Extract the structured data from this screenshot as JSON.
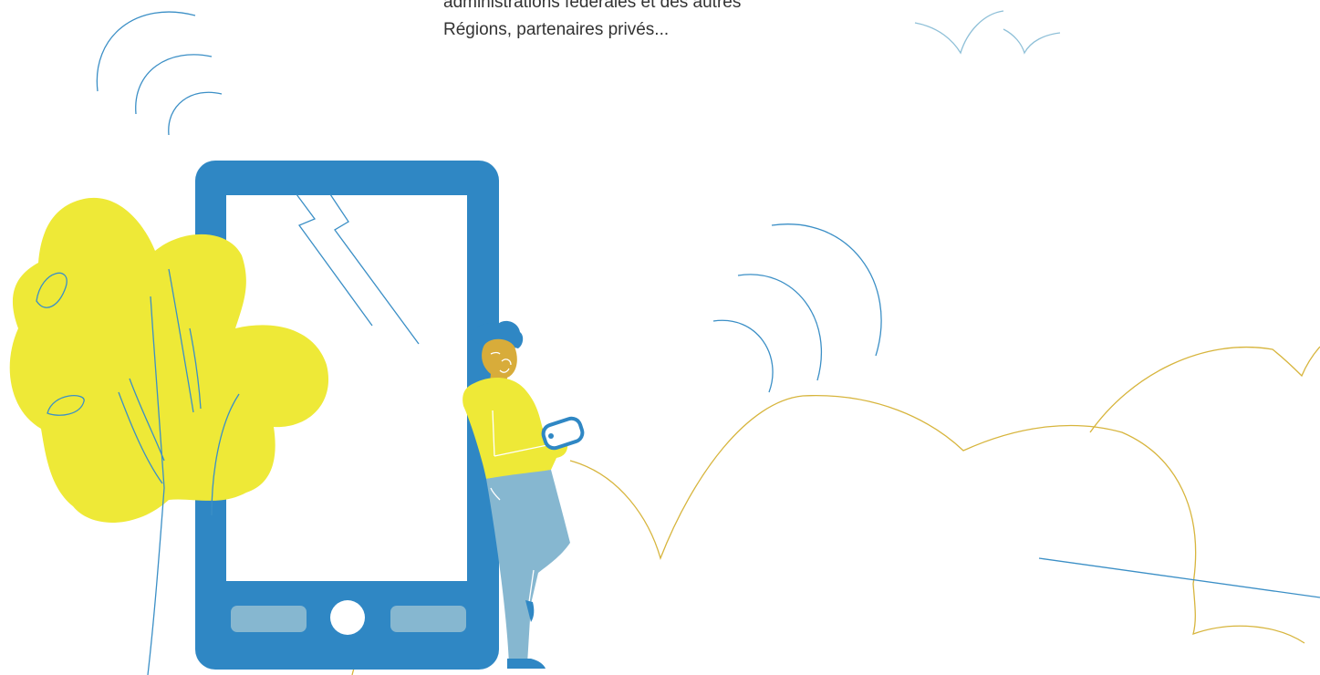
{
  "intro": {
    "line_1": "administrations fédérales et des autres",
    "line_2": "Régions, partenaires privés..."
  },
  "colors": {
    "phone_blue": "#2f87c4",
    "tree_yellow": "#eee937",
    "line_blue": "#3b8fc6",
    "line_gold": "#d7b53d",
    "skin": "#d8ac3a",
    "jeans": "#86b7d0",
    "button_grey_blue": "#86b7d0",
    "light_blue": "#8fc0d8",
    "text": "#333333"
  },
  "icons": [
    "smartphone-icon",
    "person-icon",
    "tree-icon",
    "signal-waves-icon",
    "bird-icon",
    "cloud-outline-icon"
  ]
}
